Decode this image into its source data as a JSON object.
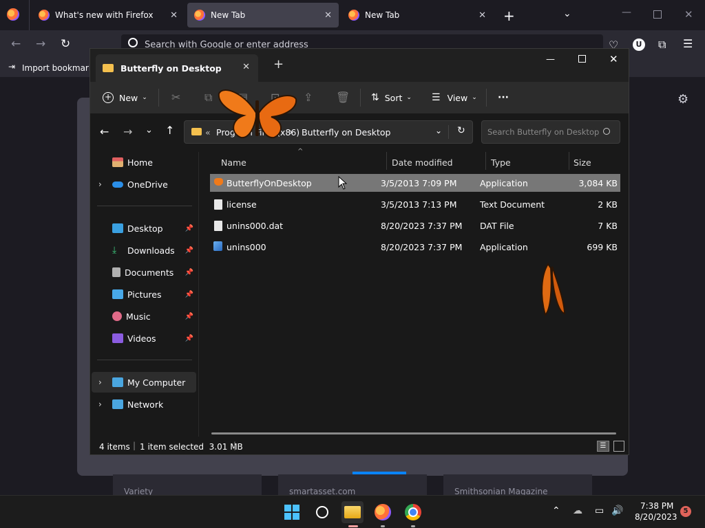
{
  "firefox": {
    "tabs": [
      {
        "label": "What's new with Firefox"
      },
      {
        "label": "New Tab"
      },
      {
        "label": "New Tab"
      }
    ],
    "address_placeholder": "Search with Google or enter address",
    "bookmark_import_label": "Import bookmarks",
    "tiles": [
      "Variety",
      "smartasset.com",
      "Smithsonian Magazine"
    ]
  },
  "explorer": {
    "tab_title": "Butterfly on Desktop",
    "toolbar": {
      "new_label": "New",
      "sort_label": "Sort",
      "view_label": "View",
      "more_label": "···"
    },
    "breadcrumb": {
      "overflow": "«",
      "parent": "Program Files (x86)",
      "current": "Butterfly on Desktop"
    },
    "search_placeholder": "Search Butterfly on Desktop",
    "nav": {
      "home": "Home",
      "onedrive": "OneDrive",
      "pinned": [
        "Desktop",
        "Downloads",
        "Documents",
        "Pictures",
        "Music",
        "Videos"
      ],
      "my_computer": "My Computer",
      "network": "Network"
    },
    "columns": {
      "name": "Name",
      "date": "Date modified",
      "type": "Type",
      "size": "Size"
    },
    "files": [
      {
        "name": "ButterflyOnDesktop",
        "date": "3/5/2013 7:09 PM",
        "type": "Application",
        "size": "3,084 KB"
      },
      {
        "name": "license",
        "date": "3/5/2013 7:13 PM",
        "type": "Text Document",
        "size": "2 KB"
      },
      {
        "name": "unins000.dat",
        "date": "8/20/2023 7:37 PM",
        "type": "DAT File",
        "size": "7 KB"
      },
      {
        "name": "unins000",
        "date": "8/20/2023 7:37 PM",
        "type": "Application",
        "size": "699 KB"
      }
    ],
    "status": {
      "items": "4 items",
      "selected": "1 item selected  3.01 MB"
    }
  },
  "taskbar": {
    "time": "7:38 PM",
    "date": "8/20/2023",
    "notification_count": "5"
  },
  "colors": {
    "selection": "#777777",
    "accent": "#0a84ff",
    "folder": "#f4c04e",
    "butterfly": "#f07a1a"
  }
}
